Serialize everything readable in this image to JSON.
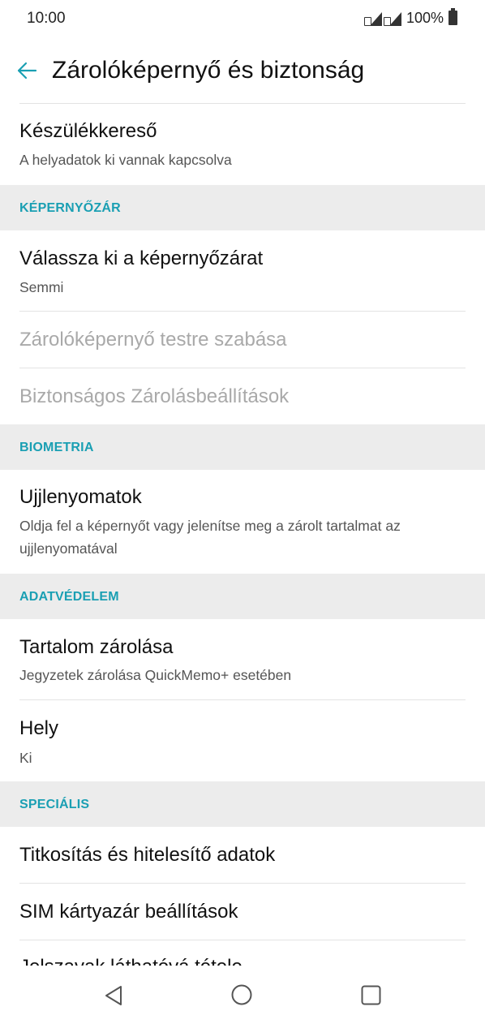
{
  "status_bar": {
    "time": "10:00",
    "battery": "100%",
    "icons": [
      "sim-signal-icon",
      "sim-signal-icon",
      "battery-icon"
    ]
  },
  "toolbar": {
    "title": "Zárolóképernyő és biztonság",
    "back_icon": "arrow-back-icon",
    "accent_color": "#1a9fb3"
  },
  "items": {
    "device_finder": {
      "title": "Készülékkereső",
      "subtitle": "A helyadatok ki vannak kapcsolva"
    },
    "screen_lock": {
      "title": "Válassza ki a képernyőzárat",
      "subtitle": "Semmi"
    },
    "lockscreen_customize": {
      "title": "Zárolóképernyő testre szabása"
    },
    "secure_lock": {
      "title": "Biztonságos Zárolásbeállítások"
    },
    "fingerprints": {
      "title": "Ujjlenyomatok",
      "subtitle": "Oldja fel a képernyőt vagy jelenítse meg a zárolt tartalmat az ujjlenyomatával"
    },
    "content_lock": {
      "title": "Tartalom zárolása",
      "subtitle": "Jegyzetek zárolása QuickMemo+ esetében"
    },
    "location": {
      "title": "Hely",
      "subtitle": "Ki"
    },
    "encryption": {
      "title": "Titkosítás és hitelesítő adatok"
    },
    "sim_lock": {
      "title": "SIM kártyazár beállítások"
    },
    "partial": {
      "title": "Jelszavak láthatóvá tétele"
    }
  },
  "sections": {
    "screen_lock": "KÉPERNYŐZÁR",
    "biometrics": "BIOMETRIA",
    "privacy": "ADATVÉDELEM",
    "special": "SPECIÁLIS"
  },
  "nav_bar": {
    "icons": [
      "nav-back-icon",
      "nav-home-icon",
      "nav-recents-icon"
    ]
  }
}
